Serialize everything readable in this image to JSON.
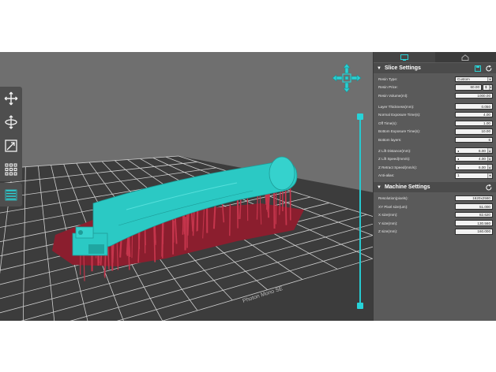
{
  "viewport": {
    "plate_label": "Photon Mono SE",
    "colors": {
      "background": "#6f6f6f",
      "plate": "#3a3a3a",
      "grid": "#d4d4d4",
      "model": "#2bc9c4",
      "supports": "#c0334a",
      "raft": "#8a1f2d",
      "accent": "#27c9cf"
    }
  },
  "toolbar": {
    "tools": [
      {
        "icon": "move-icon"
      },
      {
        "icon": "rotate-icon"
      },
      {
        "icon": "scale-icon"
      },
      {
        "icon": "arrange-grid-icon"
      }
    ],
    "layers_icon": "layers-icon"
  },
  "panel": {
    "tabs": [
      {
        "icon": "monitor-icon"
      },
      {
        "icon": "home-icon"
      }
    ],
    "slice": {
      "title": "Slice Settings",
      "resin_type_label": "Resin Type:",
      "resin_type_value": "Custom",
      "resin_price_label": "Resin Price:",
      "resin_price_value": "60.00",
      "resin_price_unit": "$",
      "resin_volume_label": "Resin Volume(ml):",
      "resin_volume_value": "1000.00",
      "layer_thickness_label": "Layer Thickness(mm):",
      "layer_thickness_value": "0.050",
      "normal_exposure_label": "Normal Exposure Time(s):",
      "normal_exposure_value": "4.00",
      "off_time_label": "Off Time(s):",
      "off_time_value": "1.00",
      "bottom_exposure_label": "Bottom Exposure Time(s):",
      "bottom_exposure_value": "10.00",
      "bottom_layers_label": "Bottom layers:",
      "bottom_layers_value": "6",
      "z_lift_distance_label": "Z Lift Distance(mm):",
      "z_lift_distance_value": "6.00",
      "z_lift_speed_label": "Z Lift Speed(mm/s):",
      "z_lift_speed_value": "4.00",
      "z_retract_speed_label": "Z Retract Speed(mm/s):",
      "z_retract_speed_value": "6.00",
      "anti_alias_label": "Anti-alias:",
      "anti_alias_value": "1"
    },
    "machine": {
      "title": "Machine Settings",
      "resolution_label": "Resolution(pixels):",
      "resolution_value": "1620x2560",
      "xy_pixel_label": "XY Pixel size(um):",
      "xy_pixel_value": "51.000",
      "x_size_label": "X size(mm):",
      "x_size_value": "82.620",
      "y_size_label": "Y size(mm):",
      "y_size_value": "130.560",
      "z_size_label": "Z size(mm):",
      "z_size_value": "160.000"
    }
  }
}
